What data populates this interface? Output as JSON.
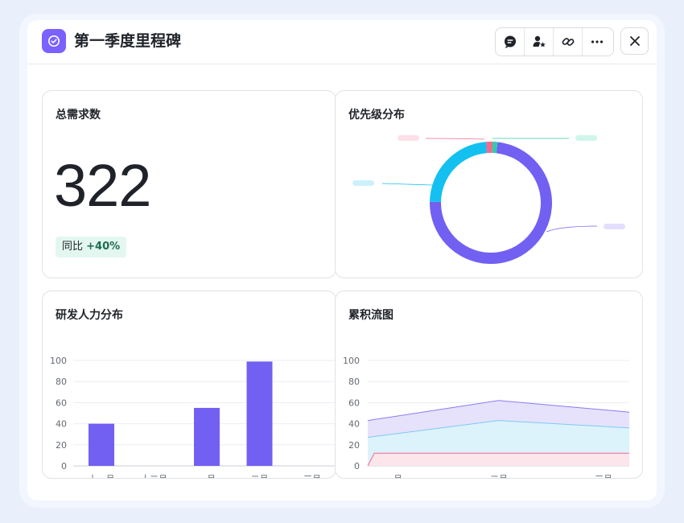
{
  "header": {
    "title": "第一季度里程碑",
    "toolbar_icons": [
      "comment-icon",
      "user-star-icon",
      "link-icon",
      "more-icon"
    ],
    "close_icon": "close-icon"
  },
  "cards": {
    "total": {
      "title": "总需求数",
      "value": "322",
      "yoy_label": "同比",
      "yoy_value": "+40%"
    },
    "priority": {
      "title": "优先级分布"
    },
    "rd": {
      "title": "研发人力分布"
    },
    "cumulative": {
      "title": "累积流图"
    }
  },
  "colors": {
    "accent": "#7b61ff",
    "purple": "#7260f2",
    "cyan": "#14c0f0",
    "pink": "#f06b8f",
    "teal": "#2ccfa8",
    "yoy_bg": "#e3f7f0"
  },
  "chart_data": [
    {
      "type": "pie",
      "title": "优先级分布",
      "donut": true,
      "slices": [
        {
          "value": 73.5,
          "color": "#7260f2"
        },
        {
          "value": 23.5,
          "color": "#14c0f0"
        },
        {
          "value": 1.7,
          "color": "#f06b8f"
        },
        {
          "value": 1.3,
          "color": "#2ccfa8"
        }
      ]
    },
    {
      "type": "bar",
      "title": "研发人力分布",
      "categories": [
        "十一月",
        "十二月",
        "一月",
        "二月",
        "三月"
      ],
      "values": [
        40,
        0,
        55,
        99,
        0
      ],
      "ylim": [
        0,
        100
      ],
      "yticks": [
        0,
        20,
        40,
        60,
        80,
        100
      ],
      "color": "#7260f2",
      "grid": true
    },
    {
      "type": "area",
      "title": "累积流图",
      "categories": [
        "一月",
        "二月",
        "三月"
      ],
      "ylim": [
        0,
        100
      ],
      "yticks": [
        0,
        20,
        40,
        60,
        80,
        100
      ],
      "series": [
        {
          "values": [
            0,
            12,
            12,
            12
          ],
          "x": [
            0,
            0.05,
            1,
            2
          ],
          "color": "#f06b8f"
        },
        {
          "values": [
            27,
            43,
            36
          ],
          "x": [
            0,
            1,
            2
          ],
          "color": "#7ec9f5"
        },
        {
          "values": [
            43,
            62,
            51
          ],
          "x": [
            0,
            1,
            2
          ],
          "color": "#8a7cf0"
        }
      ]
    }
  ]
}
